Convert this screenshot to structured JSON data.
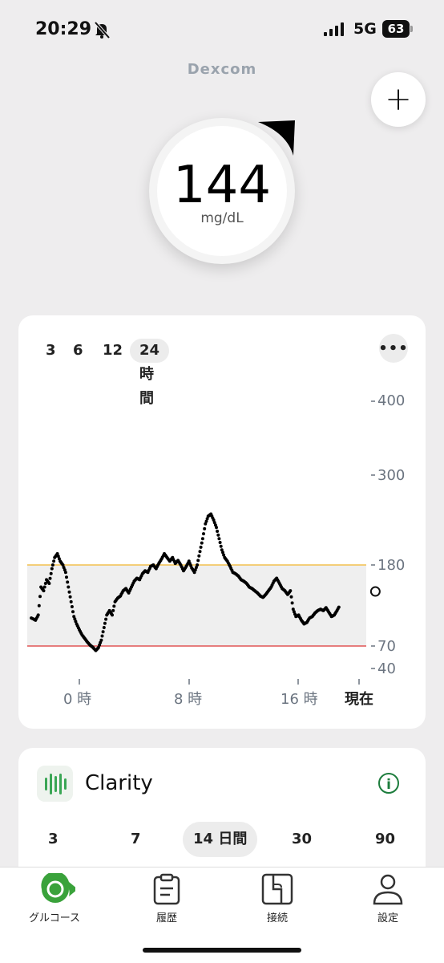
{
  "status_bar": {
    "time": "20:29",
    "network": "5G",
    "battery": "63"
  },
  "brand": "Dexcom",
  "add_button_label": "+",
  "glucose": {
    "value": "144",
    "unit": "mg/dL"
  },
  "chart_card": {
    "ranges": [
      "3",
      "6",
      "12",
      "24 時間"
    ],
    "selected_range": "24 時間",
    "more_label": "•••"
  },
  "chart_data": {
    "type": "scatter",
    "x_tick_labels": [
      "0 時",
      "8 時",
      "16 時",
      "現在"
    ],
    "y_tick_labels": [
      "400",
      "300",
      "180",
      "70",
      "40"
    ],
    "target_range": [
      70,
      180
    ],
    "target_high_color": "#f2c14e",
    "target_low_color": "#e05555",
    "x_range_hours": [
      -2.5,
      21.6
    ],
    "ylim": [
      40,
      400
    ],
    "current_point": {
      "x_hour": 21.6,
      "y": 144
    },
    "x_hours": [
      -3.5,
      -3.2,
      -3.0,
      -2.8,
      -2.6,
      -2.4,
      -2.2,
      -2.0,
      -1.8,
      -1.6,
      -1.4,
      -1.2,
      -1.0,
      -0.8,
      -0.6,
      -0.4,
      -0.2,
      0.0,
      0.2,
      0.4,
      0.6,
      0.8,
      1.0,
      1.2,
      1.4,
      1.6,
      1.8,
      2.0,
      2.2,
      2.4,
      2.6,
      2.8,
      3.0,
      3.2,
      3.4,
      3.6,
      3.8,
      4.0,
      4.2,
      4.4,
      4.6,
      4.8,
      5.0,
      5.2,
      5.4,
      5.6,
      5.8,
      6.0,
      6.2,
      6.4,
      6.6,
      6.8,
      7.0,
      7.2,
      7.4,
      7.6,
      7.8,
      8.0,
      8.2,
      8.4,
      8.6,
      8.8,
      9.0,
      9.2,
      9.4,
      9.6,
      9.8,
      10.0,
      10.2,
      10.4,
      10.6,
      10.8,
      11.0,
      11.2,
      11.4,
      11.6,
      11.8,
      12.0,
      12.2,
      12.4,
      12.6,
      12.8,
      13.0,
      13.2,
      13.4,
      13.6,
      13.8,
      14.0,
      14.2,
      14.4,
      14.6,
      14.8,
      15.0,
      15.2,
      15.4,
      15.6,
      15.8,
      16.0,
      16.2,
      16.4,
      16.6,
      16.8,
      17.0,
      17.2,
      17.4,
      17.6,
      17.8,
      18.0,
      18.2,
      18.4,
      18.6,
      18.8,
      19.0,
      19.2,
      19.4,
      19.6,
      19.8,
      20.0,
      20.2,
      20.4,
      20.6,
      20.8,
      21.0,
      21.2
    ],
    "values": [
      108,
      105,
      112,
      150,
      145,
      160,
      155,
      175,
      190,
      195,
      185,
      180,
      170,
      150,
      130,
      110,
      100,
      92,
      85,
      80,
      75,
      71,
      68,
      64,
      68,
      78,
      95,
      112,
      118,
      112,
      130,
      135,
      138,
      145,
      148,
      142,
      150,
      158,
      162,
      160,
      168,
      172,
      170,
      178,
      180,
      175,
      182,
      188,
      195,
      190,
      185,
      190,
      182,
      186,
      180,
      172,
      178,
      185,
      176,
      170,
      180,
      198,
      215,
      235,
      245,
      248,
      240,
      230,
      215,
      200,
      190,
      185,
      178,
      170,
      168,
      165,
      160,
      158,
      155,
      150,
      148,
      145,
      142,
      138,
      136,
      140,
      145,
      150,
      158,
      162,
      155,
      148,
      145,
      140,
      145,
      120,
      110,
      112,
      105,
      100,
      102,
      108,
      110,
      115,
      118,
      120,
      118,
      122,
      116,
      110,
      112,
      118,
      125
    ]
  },
  "clarity": {
    "title": "Clarity",
    "periods": [
      "3",
      "7",
      "14 日間",
      "30",
      "90"
    ],
    "selected_period": "14 日間",
    "info_label": "i"
  },
  "tabs": [
    {
      "label": "グルコース",
      "icon": "glucose-icon"
    },
    {
      "label": "履歴",
      "icon": "history-icon"
    },
    {
      "label": "接続",
      "icon": "connection-icon"
    },
    {
      "label": "設定",
      "icon": "settings-icon"
    }
  ]
}
